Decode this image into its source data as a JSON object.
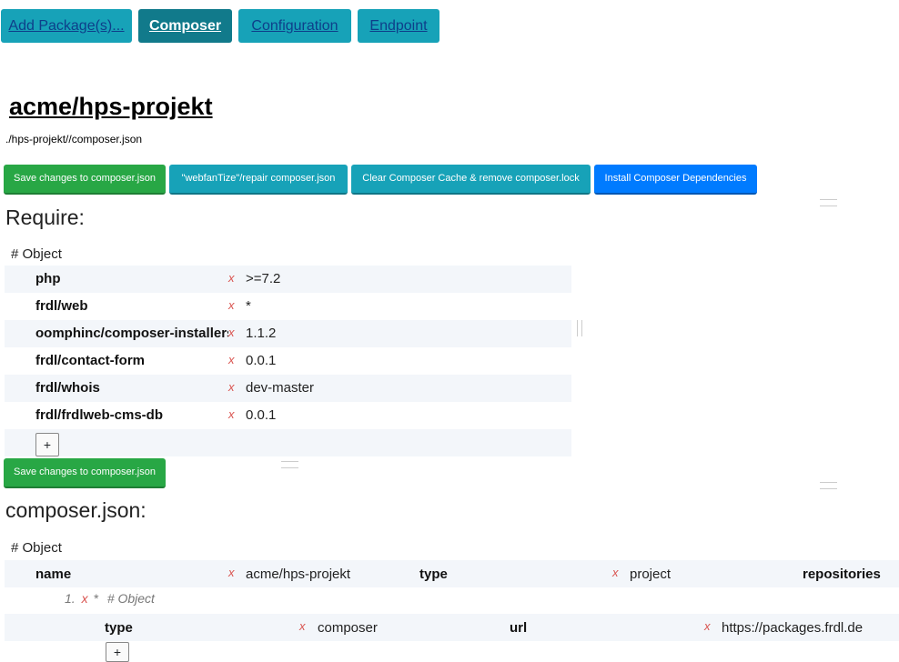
{
  "tabs": [
    {
      "label": "Add Package(s)..."
    },
    {
      "label": "Composer"
    },
    {
      "label": "Configuration"
    },
    {
      "label": "Endpoint"
    }
  ],
  "project": {
    "title": "acme/hps-projekt",
    "path": "./hps-projekt//composer.json"
  },
  "toolbar": {
    "save_label": "Save changes to composer.json",
    "repair_label": "\"webfanTize\"/repair composer.json",
    "clear_label": "Clear Composer Cache & remove composer.lock",
    "install_label": "Install Composer Dependencies"
  },
  "require": {
    "heading": "Require:",
    "object_label": "# Object",
    "remove_symbol": "x",
    "add_symbol": "+",
    "save_label": "Save changes to composer.json",
    "rows": [
      {
        "key": "php",
        "value": ">=7.2"
      },
      {
        "key": "frdl/web",
        "value": "*"
      },
      {
        "key": "oomphinc/composer-installers",
        "value": "1.1.2"
      },
      {
        "key": "frdl/contact-form",
        "value": "0.0.1"
      },
      {
        "key": "frdl/whois",
        "value": "dev-master"
      },
      {
        "key": "frdl/frdlweb-cms-db",
        "value": "0.0.1"
      }
    ]
  },
  "composer_json": {
    "heading": "composer.json:",
    "object_label": "# Object",
    "name_key": "name",
    "name_value": "acme/hps-projekt",
    "type_key": "type",
    "type_value": "project",
    "repositories_key": "repositories",
    "array_index": "1.",
    "array_star": "*",
    "array_object_label": "# Object",
    "repo_type_key": "type",
    "repo_type_value": "composer",
    "repo_url_key": "url",
    "repo_url_value": "https://packages.frdl.de",
    "add_symbol": "+"
  },
  "colors": {
    "tab": "#17a2b8",
    "tab_active": "#117a8b",
    "green": "#28a745",
    "blue": "#007bff",
    "remove": "#d9534f",
    "row_alt": "#f3f6fa"
  }
}
